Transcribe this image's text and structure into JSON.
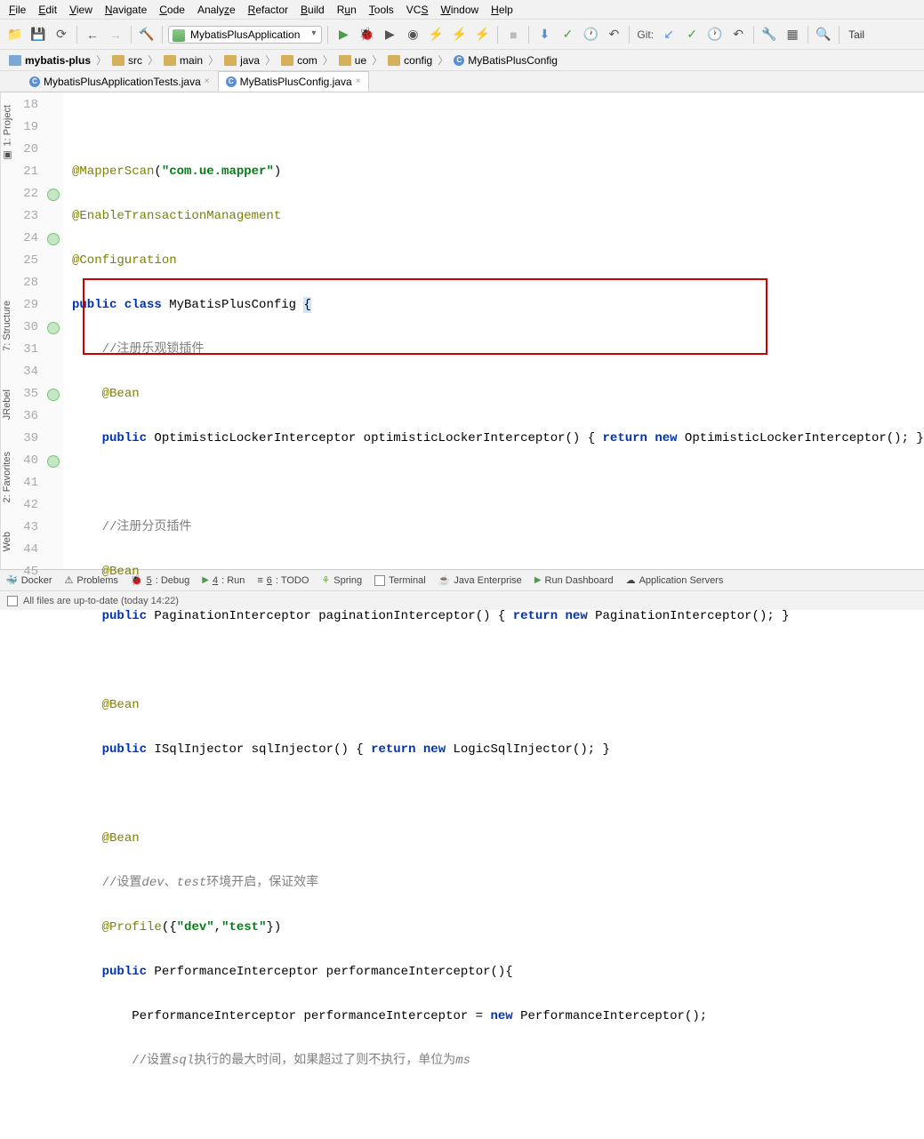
{
  "menu": {
    "items": [
      "File",
      "Edit",
      "View",
      "Navigate",
      "Code",
      "Analyze",
      "Refactor",
      "Build",
      "Run",
      "Tools",
      "VCS",
      "Window",
      "Help"
    ]
  },
  "runConfig": {
    "name": "MybatisPlusApplication",
    "git": "Git:",
    "tail": "Tail"
  },
  "breadcrumb": {
    "items": [
      "mybatis-plus",
      "src",
      "main",
      "java",
      "com",
      "ue",
      "config",
      "MyBatisPlusConfig"
    ]
  },
  "tabs": {
    "t1": "MybatisPlusApplicationTests.java",
    "t2": "MyBatisPlusConfig.java"
  },
  "gutter": {
    "lines": [
      "18",
      "19",
      "20",
      "21",
      "22",
      "23",
      "24",
      "25",
      "28",
      "29",
      "30",
      "31",
      "34",
      "35",
      "36",
      "39",
      "40",
      "41",
      "42",
      "43",
      "44",
      "45"
    ]
  },
  "code": {
    "l19a": "@MapperScan",
    "l19b": "(",
    "l19c": "\"com.ue.mapper\"",
    "l19d": ")",
    "l20": "@EnableTransactionManagement",
    "l21": "@Configuration",
    "l22a": "public class",
    "l22b": " MyBatisPlusConfig ",
    "l22c": "{",
    "l23": "//注册乐观锁插件",
    "l24": "@Bean",
    "l25a": "public",
    "l25b": " OptimisticLockerInterceptor optimisticLockerInterceptor() { ",
    "l25c": "return new",
    "l25d": " OptimisticLockerInterceptor(); }",
    "l29": "//注册分页插件",
    "l30": "@Bean",
    "l31a": "public",
    "l31b": " PaginationInterceptor paginationInterceptor() { ",
    "l31c": "return new",
    "l31d": " PaginationInterceptor(); }",
    "l35": "@Bean",
    "l36a": "public",
    "l36b": " ISqlInjector sqlInjector() { ",
    "l36c": "return new",
    "l36d": " LogicSqlInjector(); }",
    "l40": "@Bean",
    "l41a": "//设置",
    "l41b": "dev",
    "l41c": "、",
    "l41d": "test",
    "l41e": "环境开启，保证效率",
    "l42a": "@Profile",
    "l42b": "({",
    "l42c": "\"dev\"",
    "l42d": ",",
    "l42e": "\"test\"",
    "l42f": "})",
    "l43a": "public",
    "l43b": " PerformanceInterceptor performanceInterceptor(){",
    "l44a": "PerformanceInterceptor performanceInterceptor = ",
    "l44b": "new",
    "l44c": " PerformanceInterceptor();",
    "l45a": "//设置",
    "l45b": "sql",
    "l45c": "执行的最大时间，如果超过了则不执行，单位为",
    "l45d": "ms"
  },
  "leftTabs": {
    "project": "1: Project",
    "structure": "7: Structure",
    "jrebel": "JRebel",
    "favorites": "2: Favorites",
    "web": "Web"
  },
  "bottomTabs": {
    "docker": "Docker",
    "problems": "Problems",
    "debug": "5: Debug",
    "run": "4: Run",
    "todo": "6: TODO",
    "spring": "Spring",
    "terminal": "Terminal",
    "java": "Java Enterprise",
    "dash": "Run Dashboard",
    "app": "Application Servers"
  },
  "status": {
    "msg": "All files are up-to-date (today 14:22)"
  }
}
